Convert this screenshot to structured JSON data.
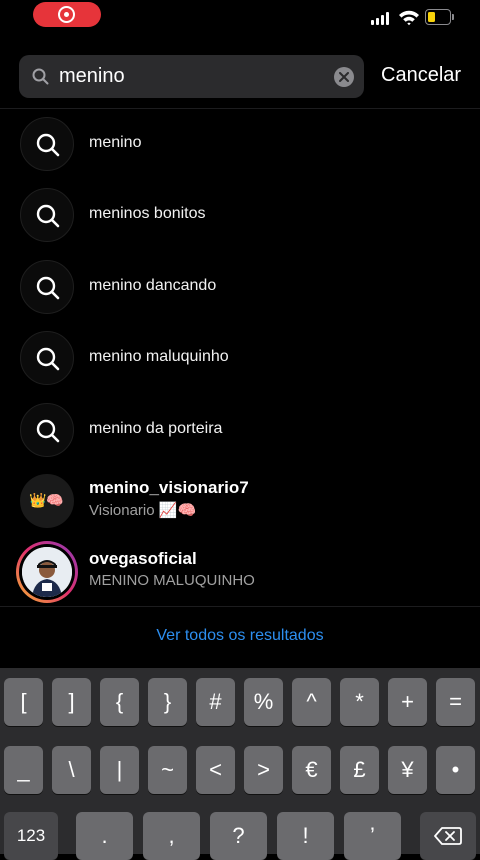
{
  "status_bar": {
    "colors": {
      "recording": "#e6343a",
      "battery": "#f7d20a"
    },
    "icons": [
      "screen-recording-icon",
      "cellular-signal-icon",
      "wifi-icon",
      "battery-icon"
    ]
  },
  "search": {
    "value": "menino",
    "cancel_label": "Cancelar"
  },
  "suggestions": [
    {
      "label": "menino"
    },
    {
      "label": "meninos bonitos"
    },
    {
      "label": "menino dancando"
    },
    {
      "label": "menino maluquinho"
    },
    {
      "label": "menino da porteira"
    }
  ],
  "accounts": [
    {
      "username": "menino_visionario7",
      "avatar_emoji": "👑🧠",
      "subtitle": "Visionario 📈🧠"
    },
    {
      "username": "ovegasoficial",
      "subtitle": "MENINO MALUQUINHO"
    }
  ],
  "see_all_label": "Ver todos os resultados",
  "keyboard": {
    "row1": [
      "[",
      "]",
      "{",
      "}",
      "#",
      "%",
      "^",
      "*",
      "+",
      "="
    ],
    "row2": [
      "_",
      "\\",
      "|",
      "~",
      "<",
      ">",
      "€",
      "£",
      "¥",
      "•"
    ],
    "row3": [
      "123",
      ".",
      ",",
      "?",
      "!",
      "’"
    ]
  }
}
